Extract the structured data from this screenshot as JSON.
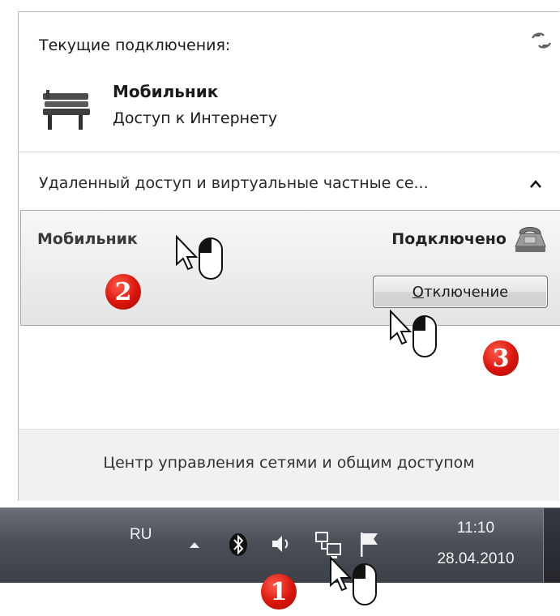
{
  "popup": {
    "current_connections_title": "Текущие подключения:",
    "network": {
      "name": "Мобильник",
      "status": "Доступ к Интернету"
    },
    "section_header": "Удаленный доступ и виртуальные частные се...",
    "vpn": {
      "name": "Мобильник",
      "state": "Подключено",
      "disconnect_accel": "О",
      "disconnect_rest": "тключение"
    },
    "footer_link": "Центр управления сетями и общим доступом"
  },
  "taskbar": {
    "language": "RU",
    "time": "11:10",
    "date": "28.04.2010"
  },
  "step_badges": [
    "2",
    "3",
    "1"
  ],
  "icons": [
    "refresh-icon",
    "bench-network-icon",
    "collapse-arrow-icon",
    "phone-modem-icon",
    "show-hidden-icons-arrow",
    "bluetooth-icon",
    "volume-icon",
    "network-icon",
    "action-center-flag-icon",
    "mouse-cursor-icon"
  ],
  "colors": {
    "badge": "#d9140c",
    "taskbar": "#4b5058"
  }
}
